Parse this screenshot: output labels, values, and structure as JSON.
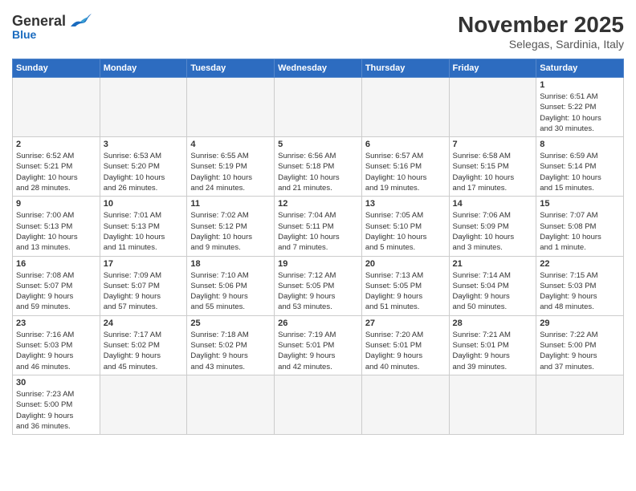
{
  "header": {
    "logo_general": "General",
    "logo_blue": "Blue",
    "month": "November 2025",
    "location": "Selegas, Sardinia, Italy"
  },
  "weekdays": [
    "Sunday",
    "Monday",
    "Tuesday",
    "Wednesday",
    "Thursday",
    "Friday",
    "Saturday"
  ],
  "days": [
    {
      "num": "",
      "info": ""
    },
    {
      "num": "",
      "info": ""
    },
    {
      "num": "",
      "info": ""
    },
    {
      "num": "",
      "info": ""
    },
    {
      "num": "",
      "info": ""
    },
    {
      "num": "",
      "info": ""
    },
    {
      "num": "1",
      "info": "Sunrise: 6:51 AM\nSunset: 5:22 PM\nDaylight: 10 hours\nand 30 minutes."
    },
    {
      "num": "2",
      "info": "Sunrise: 6:52 AM\nSunset: 5:21 PM\nDaylight: 10 hours\nand 28 minutes."
    },
    {
      "num": "3",
      "info": "Sunrise: 6:53 AM\nSunset: 5:20 PM\nDaylight: 10 hours\nand 26 minutes."
    },
    {
      "num": "4",
      "info": "Sunrise: 6:55 AM\nSunset: 5:19 PM\nDaylight: 10 hours\nand 24 minutes."
    },
    {
      "num": "5",
      "info": "Sunrise: 6:56 AM\nSunset: 5:18 PM\nDaylight: 10 hours\nand 21 minutes."
    },
    {
      "num": "6",
      "info": "Sunrise: 6:57 AM\nSunset: 5:16 PM\nDaylight: 10 hours\nand 19 minutes."
    },
    {
      "num": "7",
      "info": "Sunrise: 6:58 AM\nSunset: 5:15 PM\nDaylight: 10 hours\nand 17 minutes."
    },
    {
      "num": "8",
      "info": "Sunrise: 6:59 AM\nSunset: 5:14 PM\nDaylight: 10 hours\nand 15 minutes."
    },
    {
      "num": "9",
      "info": "Sunrise: 7:00 AM\nSunset: 5:13 PM\nDaylight: 10 hours\nand 13 minutes."
    },
    {
      "num": "10",
      "info": "Sunrise: 7:01 AM\nSunset: 5:13 PM\nDaylight: 10 hours\nand 11 minutes."
    },
    {
      "num": "11",
      "info": "Sunrise: 7:02 AM\nSunset: 5:12 PM\nDaylight: 10 hours\nand 9 minutes."
    },
    {
      "num": "12",
      "info": "Sunrise: 7:04 AM\nSunset: 5:11 PM\nDaylight: 10 hours\nand 7 minutes."
    },
    {
      "num": "13",
      "info": "Sunrise: 7:05 AM\nSunset: 5:10 PM\nDaylight: 10 hours\nand 5 minutes."
    },
    {
      "num": "14",
      "info": "Sunrise: 7:06 AM\nSunset: 5:09 PM\nDaylight: 10 hours\nand 3 minutes."
    },
    {
      "num": "15",
      "info": "Sunrise: 7:07 AM\nSunset: 5:08 PM\nDaylight: 10 hours\nand 1 minute."
    },
    {
      "num": "16",
      "info": "Sunrise: 7:08 AM\nSunset: 5:07 PM\nDaylight: 9 hours\nand 59 minutes."
    },
    {
      "num": "17",
      "info": "Sunrise: 7:09 AM\nSunset: 5:07 PM\nDaylight: 9 hours\nand 57 minutes."
    },
    {
      "num": "18",
      "info": "Sunrise: 7:10 AM\nSunset: 5:06 PM\nDaylight: 9 hours\nand 55 minutes."
    },
    {
      "num": "19",
      "info": "Sunrise: 7:12 AM\nSunset: 5:05 PM\nDaylight: 9 hours\nand 53 minutes."
    },
    {
      "num": "20",
      "info": "Sunrise: 7:13 AM\nSunset: 5:05 PM\nDaylight: 9 hours\nand 51 minutes."
    },
    {
      "num": "21",
      "info": "Sunrise: 7:14 AM\nSunset: 5:04 PM\nDaylight: 9 hours\nand 50 minutes."
    },
    {
      "num": "22",
      "info": "Sunrise: 7:15 AM\nSunset: 5:03 PM\nDaylight: 9 hours\nand 48 minutes."
    },
    {
      "num": "23",
      "info": "Sunrise: 7:16 AM\nSunset: 5:03 PM\nDaylight: 9 hours\nand 46 minutes."
    },
    {
      "num": "24",
      "info": "Sunrise: 7:17 AM\nSunset: 5:02 PM\nDaylight: 9 hours\nand 45 minutes."
    },
    {
      "num": "25",
      "info": "Sunrise: 7:18 AM\nSunset: 5:02 PM\nDaylight: 9 hours\nand 43 minutes."
    },
    {
      "num": "26",
      "info": "Sunrise: 7:19 AM\nSunset: 5:01 PM\nDaylight: 9 hours\nand 42 minutes."
    },
    {
      "num": "27",
      "info": "Sunrise: 7:20 AM\nSunset: 5:01 PM\nDaylight: 9 hours\nand 40 minutes."
    },
    {
      "num": "28",
      "info": "Sunrise: 7:21 AM\nSunset: 5:01 PM\nDaylight: 9 hours\nand 39 minutes."
    },
    {
      "num": "29",
      "info": "Sunrise: 7:22 AM\nSunset: 5:00 PM\nDaylight: 9 hours\nand 37 minutes."
    },
    {
      "num": "30",
      "info": "Sunrise: 7:23 AM\nSunset: 5:00 PM\nDaylight: 9 hours\nand 36 minutes."
    }
  ]
}
